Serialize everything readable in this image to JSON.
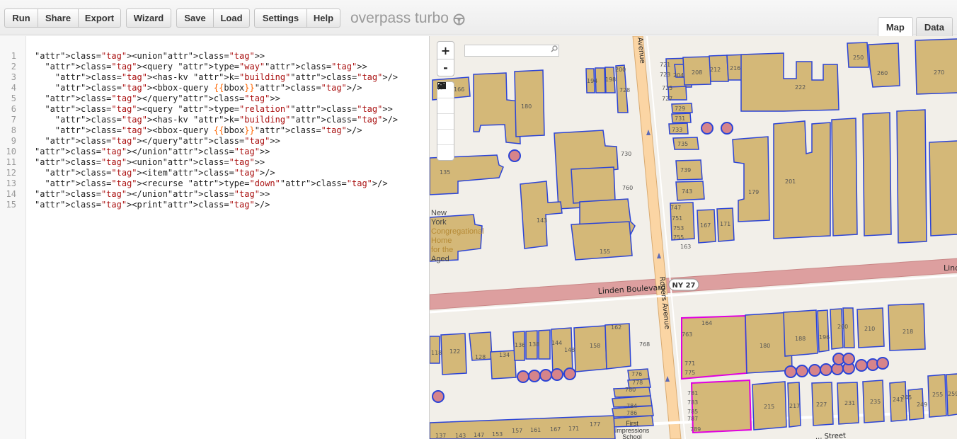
{
  "toolbar": {
    "run": "Run",
    "share": "Share",
    "export": "Export",
    "wizard": "Wizard",
    "save": "Save",
    "load": "Load",
    "settings": "Settings",
    "help": "Help"
  },
  "brand": {
    "title": "overpass turbo",
    "icon": "steering-wheel-icon"
  },
  "tabs": {
    "map": "Map",
    "data": "Data",
    "active": "Map"
  },
  "editor": {
    "line_numbers": [
      "1",
      "2",
      "3",
      "4",
      "5",
      "6",
      "7",
      "8",
      "9",
      "10",
      "11",
      "12",
      "13",
      "14",
      "15"
    ],
    "lines": [
      "<union>",
      "  <query type=\"way\">",
      "    <has-kv k=\"building\"/>",
      "    <bbox-query {{bbox}}/>",
      "  </query>",
      "  <query type=\"relation\">",
      "    <has-kv k=\"building\"/>",
      "    <bbox-query {{bbox}}/>",
      "  </query>",
      "</union>",
      "<union>",
      "  <item/>",
      "  <recurse type=\"down\"/>",
      "</union>",
      "<print/>"
    ]
  },
  "map": {
    "zoom_in": "+",
    "zoom_out": "-",
    "search_placeholder": "",
    "controls": [
      "search-icon",
      "locate-icon",
      "image-icon",
      "fit-data-icon",
      "clear-icon"
    ],
    "streets": {
      "rogers_top": "Avenue",
      "rogers_mid": "Rogers Avenue",
      "linden": "Linden Boulevard",
      "ny27": "NY 27",
      "linden_right": "Lind",
      "bottom_street": "... Street"
    },
    "pois": {
      "ny_home": [
        "New",
        "York",
        "Congregational",
        "Home",
        "for the",
        "Aged"
      ],
      "first_impressions": [
        "First",
        "Impressions",
        "School"
      ]
    },
    "house_numbers": {
      "n166": "166",
      "n180": "180",
      "n194": "194",
      "n198": "198",
      "n200": "200",
      "n728": "728",
      "n135": "135",
      "n730": "730",
      "n760": "760",
      "n143": "143",
      "n155": "155",
      "n721": "721",
      "n723": "723",
      "n204": "204",
      "n208": "208",
      "n212": "212",
      "n216": "216",
      "n725": "725",
      "n727": "727",
      "n729": "729",
      "n731": "731",
      "n733": "733",
      "n735": "735",
      "n739": "739",
      "n743": "743",
      "n747": "747",
      "n751": "751",
      "n753": "753",
      "n755": "755",
      "n163": "163",
      "n167": "167",
      "n171": "171",
      "n179": "179",
      "n201": "201",
      "n222": "222",
      "n250": "250",
      "n260": "260",
      "n270": "270",
      "n118": "118",
      "n122": "122",
      "n128": "128",
      "n134": "134",
      "n136": "136",
      "n138": "138",
      "n144": "144",
      "n148": "148",
      "n158": "158",
      "n162": "162",
      "n768": "768",
      "n776": "776",
      "n778": "778",
      "n780": "780",
      "n784": "784",
      "n786": "786",
      "n763": "763",
      "n164": "164",
      "n180b": "180",
      "n188": "188",
      "n196": "196",
      "n200b": "200",
      "n210": "210",
      "n218": "218",
      "n771": "771",
      "n775": "775",
      "n781": "781",
      "n783": "783",
      "n785": "785",
      "n787": "787",
      "n789": "789",
      "n215": "215",
      "n217": "217",
      "n227": "227",
      "n231": "231",
      "n235": "235",
      "n241": "241",
      "n245": "245",
      "n249": "249",
      "n255": "255",
      "n259": "259",
      "n137": "137",
      "n143b": "143",
      "n147": "147",
      "n153": "153",
      "n157": "157",
      "n161": "161",
      "n167b": "167",
      "n171b": "171",
      "n177": "177"
    }
  }
}
